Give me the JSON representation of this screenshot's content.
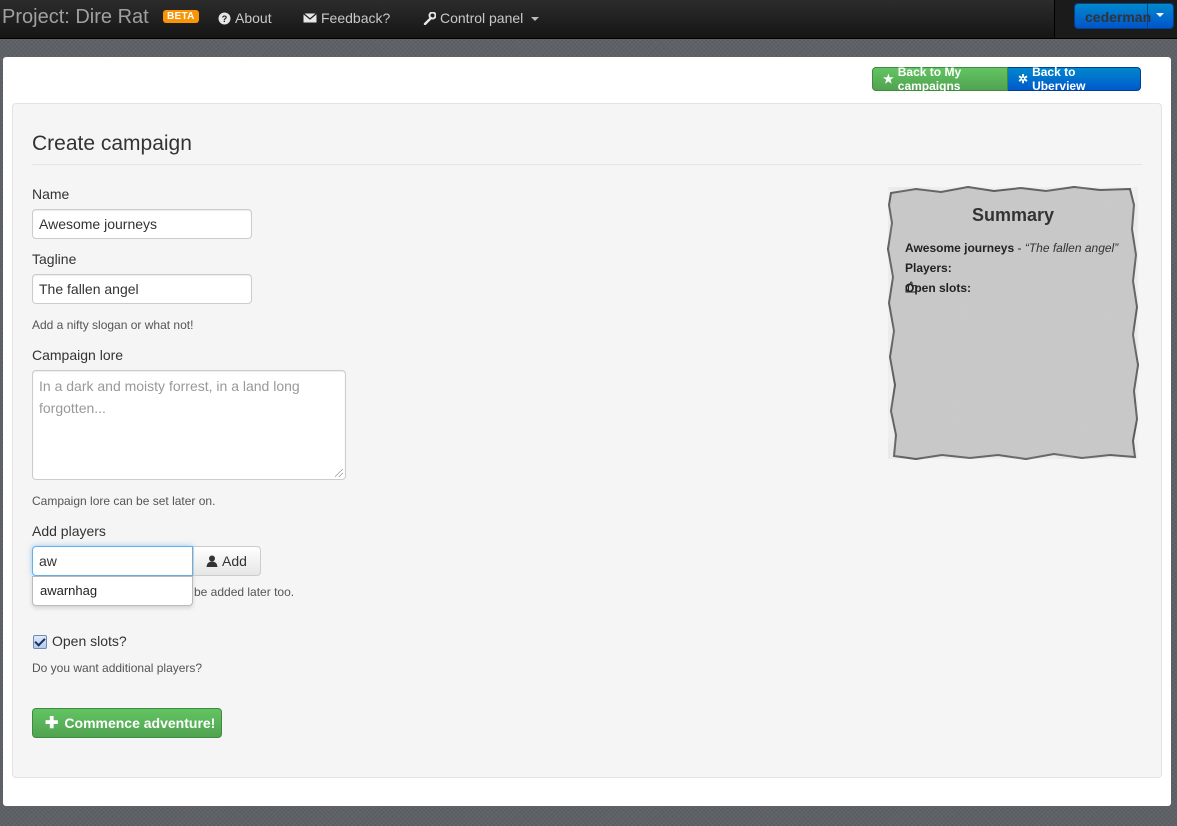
{
  "navbar": {
    "brand": "Project: Dire Rat",
    "badge": "BETA",
    "links": [
      {
        "label": "About",
        "icon": "question-circle-icon"
      },
      {
        "label": "Feedback?",
        "icon": "envelope-icon"
      },
      {
        "label": "Control panel",
        "icon": "wrench-icon"
      }
    ],
    "user": "cederman"
  },
  "actions": {
    "back_campaigns": "Back to My campaigns",
    "back_uberview": "Back to Uberview"
  },
  "form": {
    "title": "Create campaign",
    "name": {
      "label": "Name",
      "value": "Awesome journeys"
    },
    "tagline": {
      "label": "Tagline",
      "value": "The fallen angel",
      "help": "Add a nifty slogan or what not!"
    },
    "lore": {
      "label": "Campaign lore",
      "placeholder": "In a dark and moisty forrest, in a land long forgotten...",
      "help": "Campaign lore can be set later on."
    },
    "players": {
      "label": "Add players",
      "value": "aw",
      "add_label": "Add",
      "suggestion": "awarnhag",
      "help_visible": "be added later too."
    },
    "open_slots": {
      "label": "Open slots?",
      "checked": true,
      "help": "Do you want additional players?"
    },
    "submit": "Commence adventure!"
  },
  "summary": {
    "title": "Summary",
    "campaign_name": "Awesome journeys",
    "separator": " - ",
    "tagline": "“The fallen angel”",
    "players_label": "Players:",
    "open_slots_label": "Open slots:",
    "open_slots_icon": "thumbs-up-icon"
  },
  "colors": {
    "navbar": "#1b1b1b",
    "beta_badge": "#f89406",
    "primary": "#0074cc",
    "success": "#5bb75b"
  }
}
